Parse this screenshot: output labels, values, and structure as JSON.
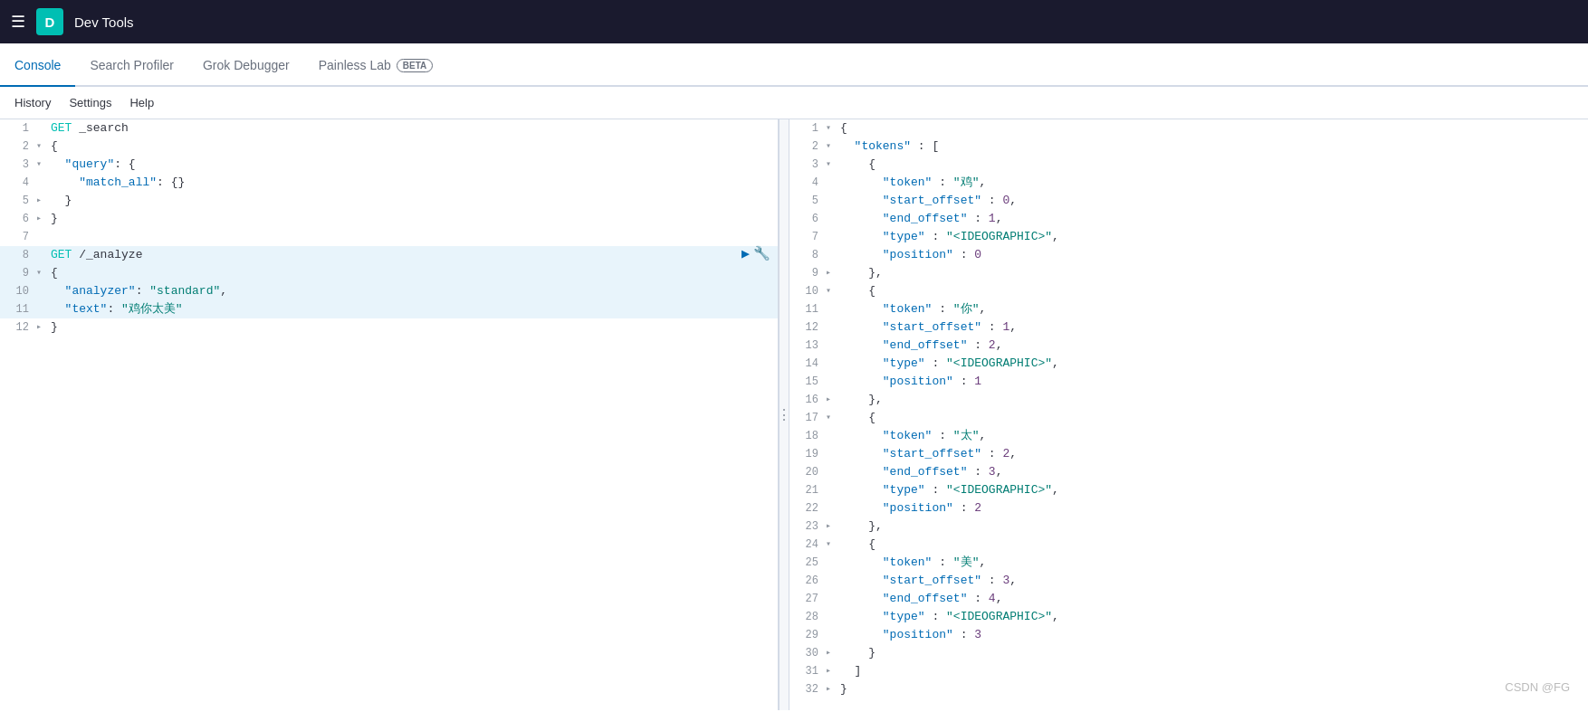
{
  "topbar": {
    "icon_label": "D",
    "app_title": "Dev Tools"
  },
  "tabs": [
    {
      "id": "console",
      "label": "Console",
      "active": true,
      "beta": false
    },
    {
      "id": "search-profiler",
      "label": "Search Profiler",
      "active": false,
      "beta": false
    },
    {
      "id": "grok-debugger",
      "label": "Grok Debugger",
      "active": false,
      "beta": false
    },
    {
      "id": "painless-lab",
      "label": "Painless Lab",
      "active": false,
      "beta": true
    }
  ],
  "toolbar": {
    "history": "History",
    "settings": "Settings",
    "help": "Help"
  },
  "editor": {
    "lines": [
      {
        "num": "1",
        "arrow": "",
        "code": "GET _search",
        "highlighted": false,
        "method": true
      },
      {
        "num": "2",
        "arrow": "▾",
        "code": "{",
        "highlighted": false
      },
      {
        "num": "3",
        "arrow": "▾",
        "code": "  \"query\": {",
        "highlighted": false,
        "hasKey": true
      },
      {
        "num": "4",
        "arrow": "",
        "code": "    \"match_all\": {}",
        "highlighted": false,
        "hasKey": true
      },
      {
        "num": "5",
        "arrow": "▸",
        "code": "  }",
        "highlighted": false
      },
      {
        "num": "6",
        "arrow": "▸",
        "code": "}",
        "highlighted": false
      },
      {
        "num": "7",
        "arrow": "",
        "code": "",
        "highlighted": false
      },
      {
        "num": "8",
        "arrow": "",
        "code": "GET /_analyze",
        "highlighted": true,
        "method": true,
        "showActions": true
      },
      {
        "num": "9",
        "arrow": "▾",
        "code": "{",
        "highlighted": true
      },
      {
        "num": "10",
        "arrow": "",
        "code": "  \"analyzer\": \"standard\",",
        "highlighted": true,
        "hasKey": true
      },
      {
        "num": "11",
        "arrow": "",
        "code": "  \"text\": \"鸡你太美\"",
        "highlighted": true,
        "hasKey": true
      },
      {
        "num": "12",
        "arrow": "▸",
        "code": "}",
        "highlighted": false
      }
    ]
  },
  "output": {
    "lines": [
      {
        "num": "1",
        "arrow": "▾",
        "raw": "{"
      },
      {
        "num": "2",
        "arrow": "▾",
        "raw": "  \"tokens\" : ["
      },
      {
        "num": "3",
        "arrow": "▾",
        "raw": "    {"
      },
      {
        "num": "4",
        "arrow": "",
        "raw": "      \"token\" : \"鸡\","
      },
      {
        "num": "5",
        "arrow": "",
        "raw": "      \"start_offset\" : 0,"
      },
      {
        "num": "6",
        "arrow": "",
        "raw": "      \"end_offset\" : 1,"
      },
      {
        "num": "7",
        "arrow": "",
        "raw": "      \"type\" : \"<IDEOGRAPHIC>\","
      },
      {
        "num": "8",
        "arrow": "",
        "raw": "      \"position\" : 0"
      },
      {
        "num": "9",
        "arrow": "▸",
        "raw": "    },"
      },
      {
        "num": "10",
        "arrow": "▾",
        "raw": "    {"
      },
      {
        "num": "11",
        "arrow": "",
        "raw": "      \"token\" : \"你\","
      },
      {
        "num": "12",
        "arrow": "",
        "raw": "      \"start_offset\" : 1,"
      },
      {
        "num": "13",
        "arrow": "",
        "raw": "      \"end_offset\" : 2,"
      },
      {
        "num": "14",
        "arrow": "",
        "raw": "      \"type\" : \"<IDEOGRAPHIC>\","
      },
      {
        "num": "15",
        "arrow": "",
        "raw": "      \"position\" : 1"
      },
      {
        "num": "16",
        "arrow": "▸",
        "raw": "    },"
      },
      {
        "num": "17",
        "arrow": "▾",
        "raw": "    {"
      },
      {
        "num": "18",
        "arrow": "",
        "raw": "      \"token\" : \"太\","
      },
      {
        "num": "19",
        "arrow": "",
        "raw": "      \"start_offset\" : 2,"
      },
      {
        "num": "20",
        "arrow": "",
        "raw": "      \"end_offset\" : 3,"
      },
      {
        "num": "21",
        "arrow": "",
        "raw": "      \"type\" : \"<IDEOGRAPHIC>\","
      },
      {
        "num": "22",
        "arrow": "",
        "raw": "      \"position\" : 2"
      },
      {
        "num": "23",
        "arrow": "▸",
        "raw": "    },"
      },
      {
        "num": "24",
        "arrow": "▾",
        "raw": "    {"
      },
      {
        "num": "25",
        "arrow": "",
        "raw": "      \"token\" : \"美\","
      },
      {
        "num": "26",
        "arrow": "",
        "raw": "      \"start_offset\" : 3,"
      },
      {
        "num": "27",
        "arrow": "",
        "raw": "      \"end_offset\" : 4,"
      },
      {
        "num": "28",
        "arrow": "",
        "raw": "      \"type\" : \"<IDEOGRAPHIC>\","
      },
      {
        "num": "29",
        "arrow": "",
        "raw": "      \"position\" : 3"
      },
      {
        "num": "30",
        "arrow": "▸",
        "raw": "    }"
      },
      {
        "num": "31",
        "arrow": "▸",
        "raw": "  ]"
      },
      {
        "num": "32",
        "arrow": "▸",
        "raw": "}"
      }
    ]
  },
  "watermark": "CSDN @FG"
}
